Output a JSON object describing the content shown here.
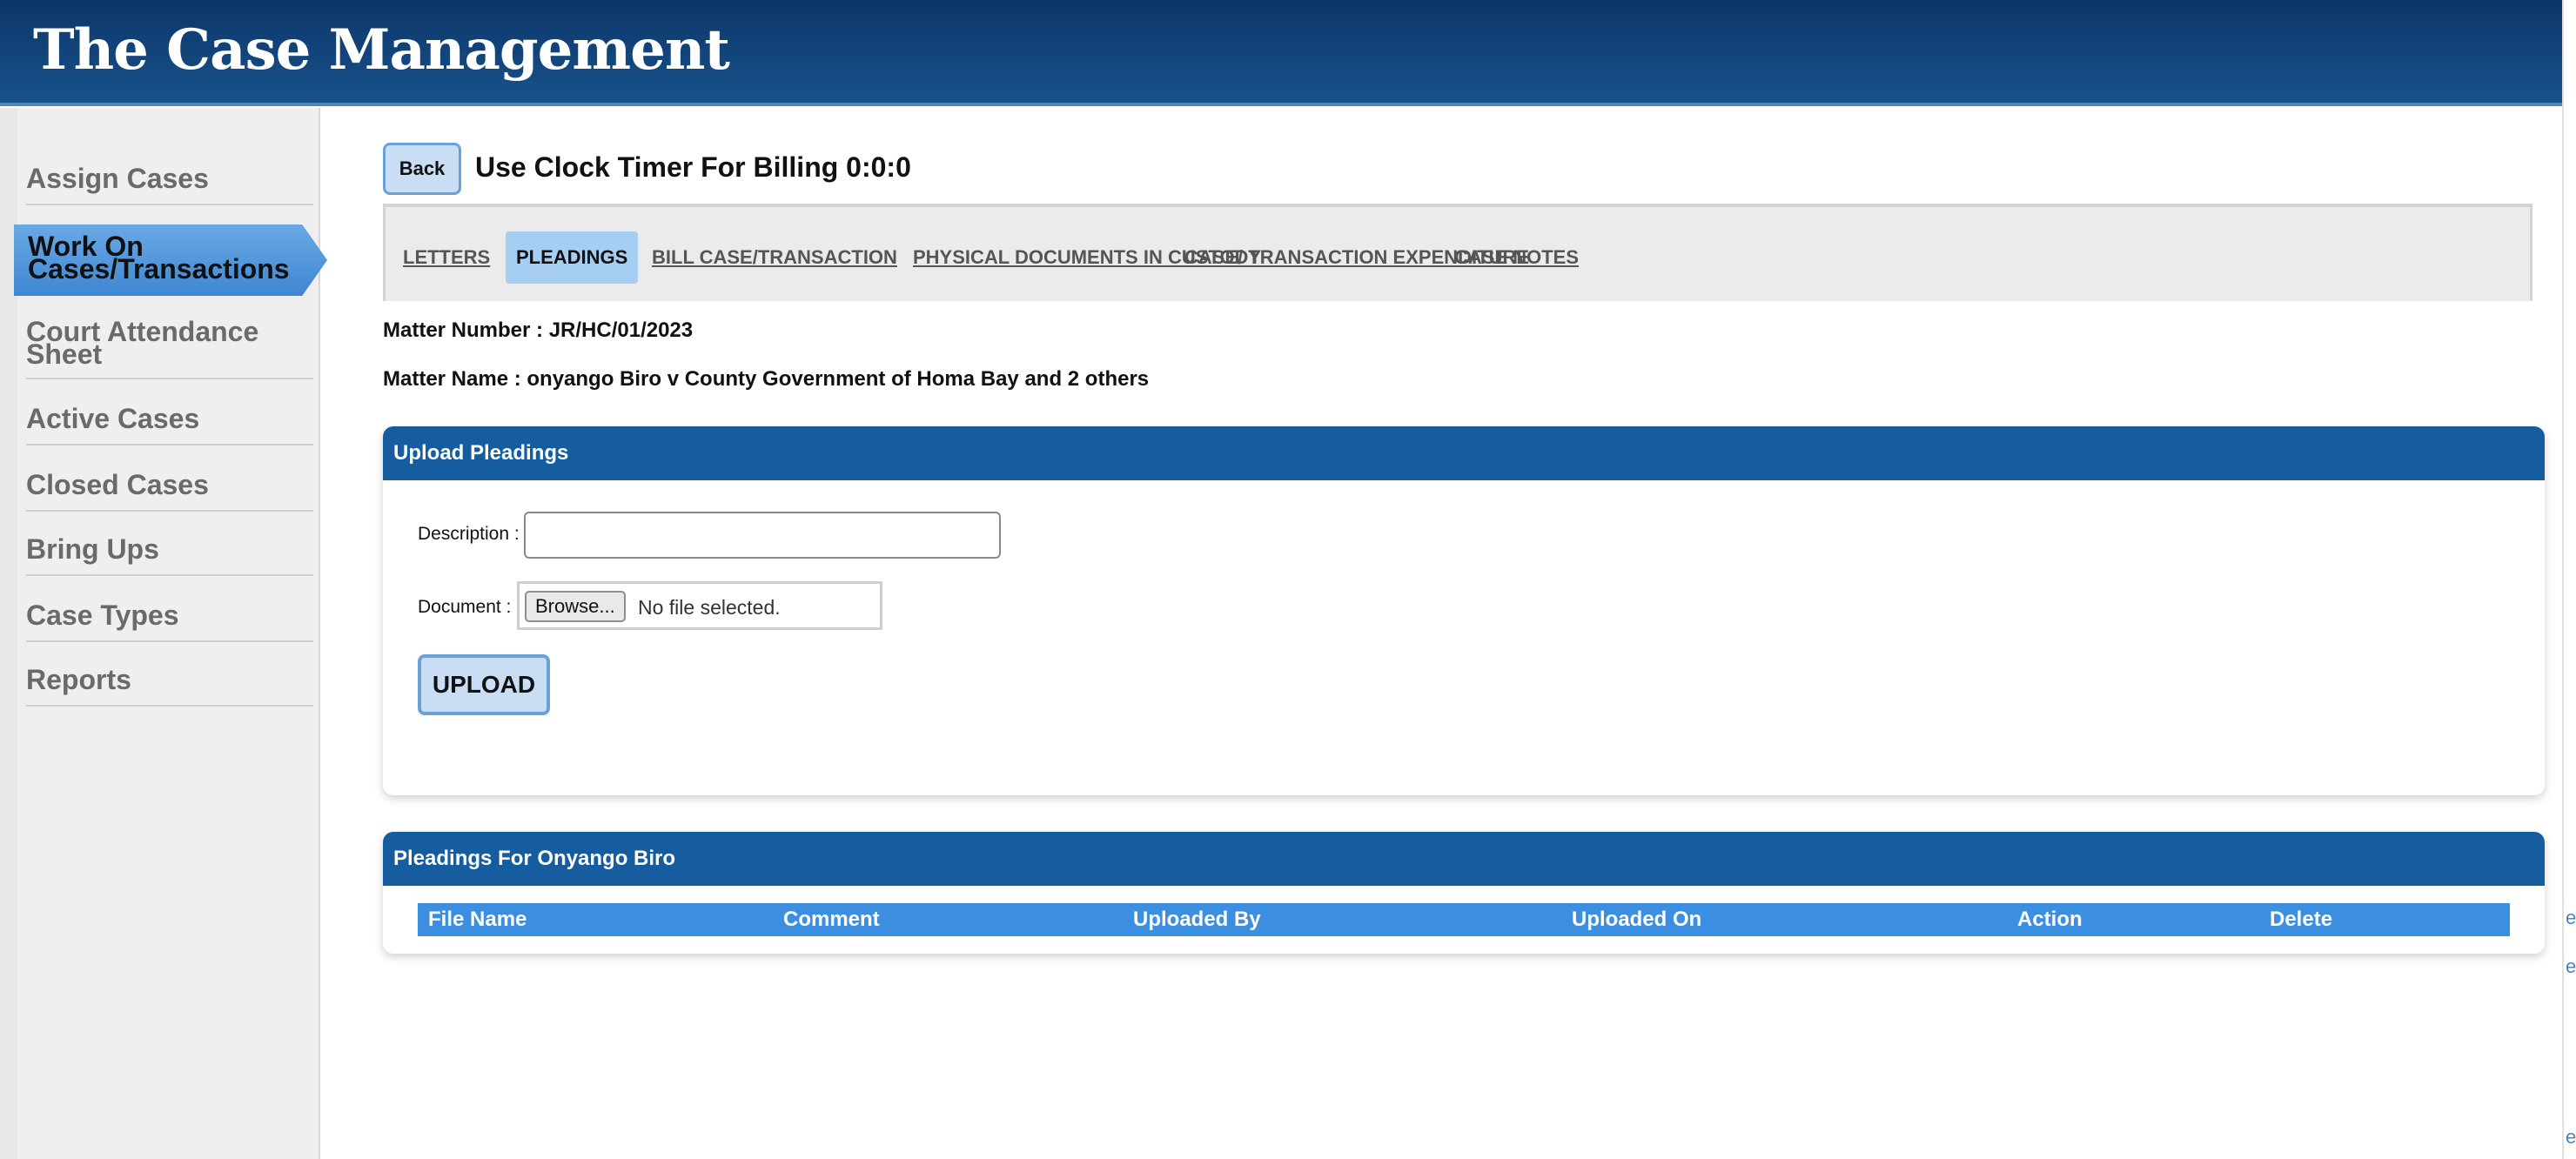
{
  "header": {
    "title": "The Case Management"
  },
  "sidebar": {
    "items": [
      {
        "label": "Assign Cases",
        "active": false
      },
      {
        "label": "Work On Cases/Transactions",
        "active": true
      },
      {
        "label": "Court Attendance Sheet",
        "active": false
      },
      {
        "label": "Active Cases",
        "active": false
      },
      {
        "label": "Closed Cases",
        "active": false
      },
      {
        "label": "Bring Ups",
        "active": false
      },
      {
        "label": "Case Types",
        "active": false
      },
      {
        "label": "Reports",
        "active": false
      }
    ]
  },
  "toolbar": {
    "back_label": "Back",
    "timer_text": "Use Clock Timer For Billing 0:0:0"
  },
  "tabs": [
    {
      "label": "LETTERS",
      "active": false
    },
    {
      "label": "PLEADINGS",
      "active": true
    },
    {
      "label": "BILL CASE/TRANSACTION",
      "active": false
    },
    {
      "label": "PHYSICAL DOCUMENTS IN CUSTODY",
      "active": false
    },
    {
      "label": "CASE/ TRANSACTION EXPENDITURE",
      "active": false
    },
    {
      "label": "CASE NOTES",
      "active": false
    }
  ],
  "matter": {
    "number_text": "Matter Number : JR/HC/01/2023",
    "name_text": "Matter Name : onyango Biro v County Government of Homa Bay and 2 others"
  },
  "upload_panel": {
    "title": "Upload Pleadings",
    "description_label": "Description :",
    "description_value": "",
    "document_label": "Document :",
    "browse_label": "Browse...",
    "file_status": "No file selected.",
    "upload_label": "UPLOAD"
  },
  "pleadings_panel": {
    "title": "Pleadings For Onyango Biro",
    "columns": [
      "File Name",
      "Comment",
      "Uploaded By",
      "Uploaded On",
      "Action",
      "Delete"
    ],
    "rows": []
  },
  "right_strip": {
    "glyphs": [
      "e",
      "e",
      "e"
    ]
  },
  "colors": {
    "header": "#0c3669",
    "panel_header": "#165d9f",
    "table_header": "#3b8ee0",
    "active_nav": "#3f86d2",
    "button_bg": "#c9def5"
  }
}
